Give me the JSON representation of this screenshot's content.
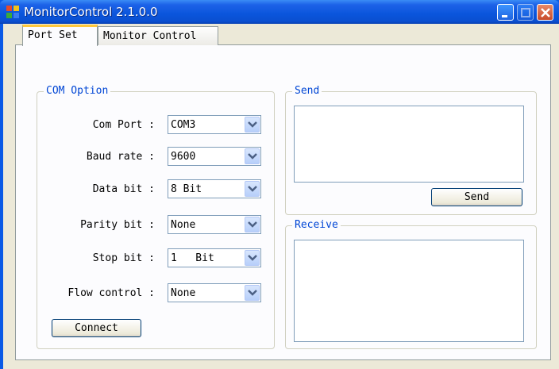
{
  "window": {
    "title": "MonitorControl  2.1.0.0",
    "icon": "app-icon",
    "controls": [
      "minimize-icon",
      "maximize-icon",
      "close-icon"
    ]
  },
  "tabs": [
    {
      "label": "Port Set",
      "active": true
    },
    {
      "label": "Monitor Control",
      "active": false
    }
  ],
  "com_option": {
    "title": "COM Option",
    "rows": [
      {
        "label": "Com Port :",
        "value": "COM3"
      },
      {
        "label": "Baud rate :",
        "value": "9600"
      },
      {
        "label": "Data bit :",
        "value": "8 Bit"
      },
      {
        "label": "Parity bit :",
        "value": "None"
      },
      {
        "label": "Stop bit :",
        "value": "1   Bit"
      },
      {
        "label": "Flow control :",
        "value": "None"
      }
    ],
    "connect_label": "Connect"
  },
  "send": {
    "title": "Send",
    "text": "",
    "button_label": "Send"
  },
  "receive": {
    "title": "Receive",
    "text": ""
  },
  "colors": {
    "titlebar": "#0A55DC",
    "group_title": "#0046D5",
    "tab_highlight": "#FFC83C",
    "client_bg": "#ECE9D8"
  }
}
